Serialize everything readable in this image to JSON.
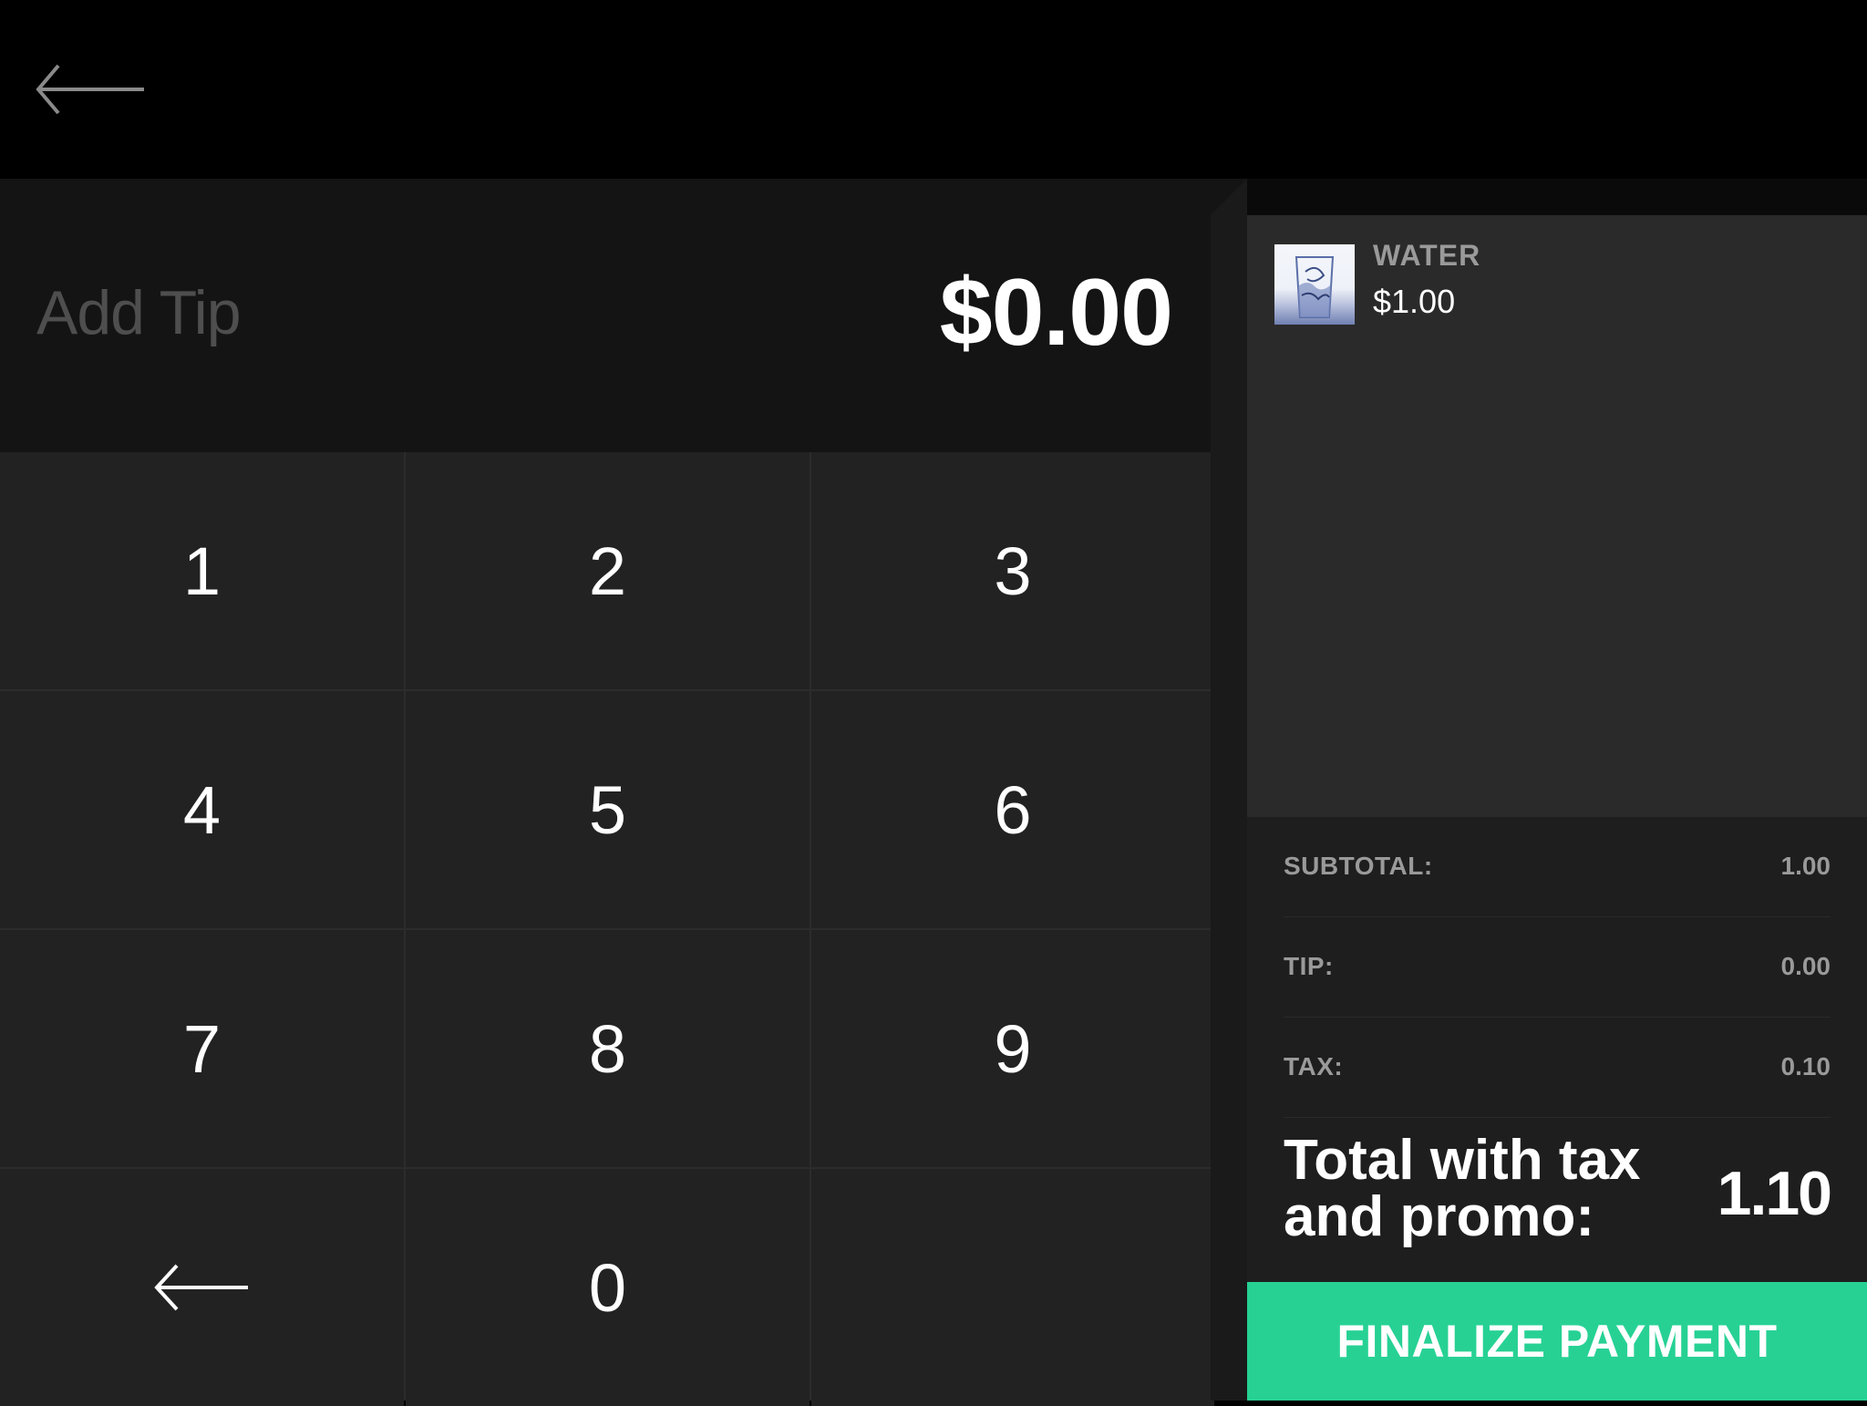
{
  "nav": {
    "back_icon": "back-arrow-icon"
  },
  "tip": {
    "label": "Add Tip",
    "amount": "$0.00"
  },
  "keypad": {
    "keys": [
      "1",
      "2",
      "3",
      "4",
      "5",
      "6",
      "7",
      "8",
      "9",
      "0"
    ],
    "backspace_icon": "backspace-arrow-icon"
  },
  "order": {
    "items": [
      {
        "name": "WATER",
        "price": "$1.00",
        "thumbnail_icon": "water-glass-image"
      }
    ]
  },
  "summary": {
    "subtotal_label": "SUBTOTAL:",
    "subtotal_value": "1.00",
    "tip_label": "TIP:",
    "tip_value": "0.00",
    "tax_label": "TAX:",
    "tax_value": "0.10",
    "total_label": "Total with tax and promo:",
    "total_value": "1.10"
  },
  "actions": {
    "finalize_label": "FINALIZE PAYMENT"
  },
  "colors": {
    "accent": "#27d194",
    "background": "#000000",
    "keypad": "#222222",
    "order_panel": "#2a2a2a",
    "muted_text": "#9a9a9a",
    "tip_label": "#4e4e4e"
  }
}
